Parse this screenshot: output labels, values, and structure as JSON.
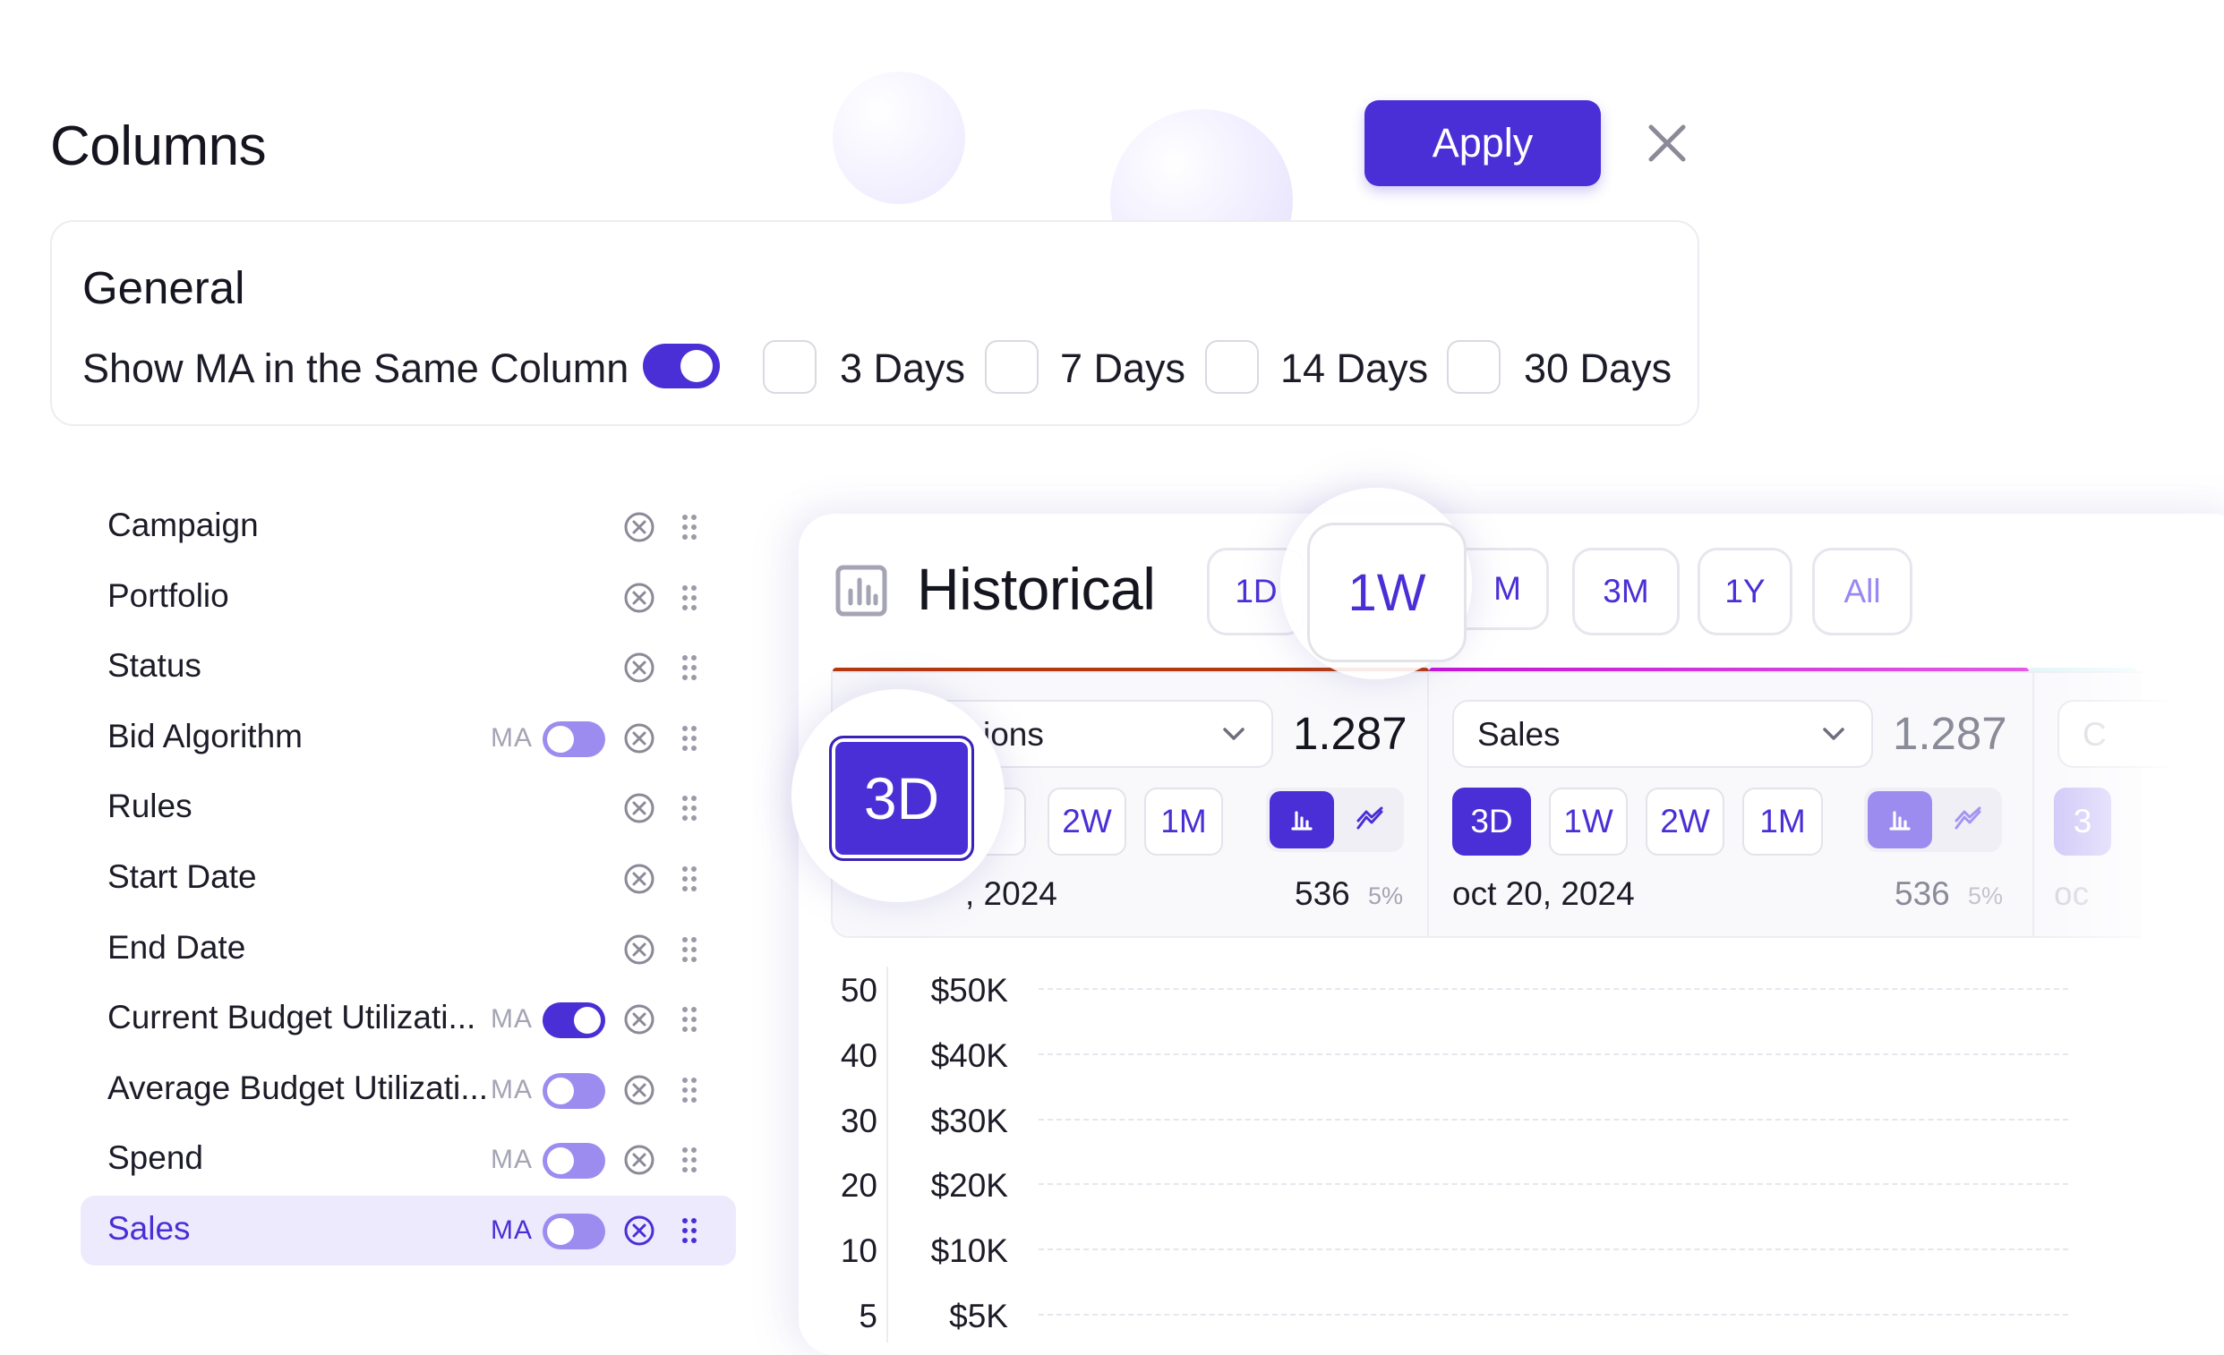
{
  "dialog": {
    "title": "Columns",
    "apply_label": "Apply"
  },
  "general": {
    "title": "General",
    "show_ma_label": "Show MA in the Same Column",
    "show_ma_on": true,
    "day_options": [
      {
        "label": "3 Days",
        "checked": false
      },
      {
        "label": "7 Days",
        "checked": false
      },
      {
        "label": "14 Days",
        "checked": false
      },
      {
        "label": "30 Days",
        "checked": false
      }
    ]
  },
  "columns": [
    {
      "label": "Campaign",
      "ma": false
    },
    {
      "label": "Portfolio",
      "ma": false
    },
    {
      "label": "Status",
      "ma": false
    },
    {
      "label": "Bid Algorithm",
      "ma": true,
      "ma_on": false
    },
    {
      "label": "Rules",
      "ma": false
    },
    {
      "label": "Start Date",
      "ma": false
    },
    {
      "label": "End Date",
      "ma": false
    },
    {
      "label": "Current Budget Utilizati...",
      "ma": true,
      "ma_on": true
    },
    {
      "label": "Average Budget Utilizati...",
      "ma": true,
      "ma_on": false
    },
    {
      "label": "Spend",
      "ma": true,
      "ma_on": false
    },
    {
      "label": "Sales",
      "ma": true,
      "ma_on": false,
      "active": true
    }
  ],
  "ma_tag": "MA",
  "historical": {
    "title": "Historical",
    "ranges": [
      "1D",
      "1W",
      "M",
      "3M",
      "1Y",
      "All"
    ],
    "active_range": "1W",
    "panels": [
      {
        "metric": "ions",
        "value": "1.287",
        "periods": [
          "2W",
          "1M"
        ],
        "active_period": "3D",
        "date": ", 2024",
        "count": "536",
        "pct": "5%",
        "accent": "#b5380f"
      },
      {
        "metric": "Sales",
        "value": "1.287",
        "periods": [
          "3D",
          "1W",
          "2W",
          "1M"
        ],
        "active_period": "3D",
        "date": "oct 20, 2024",
        "count": "536",
        "pct": "5%",
        "accent": "#d91ad9"
      }
    ],
    "partial_date": "oc",
    "partial_label": "C",
    "partial_period": "3"
  },
  "chart_data": {
    "type": "line",
    "y_left_ticks": [
      "50",
      "40",
      "30",
      "20",
      "10",
      "5"
    ],
    "y_right_ticks": [
      "$50K",
      "$40K",
      "$30K",
      "$20K",
      "$10K",
      "$5K"
    ],
    "grid": true
  },
  "colors": {
    "accent": "#4a2fd6",
    "accent_light": "#9d8cf0"
  }
}
